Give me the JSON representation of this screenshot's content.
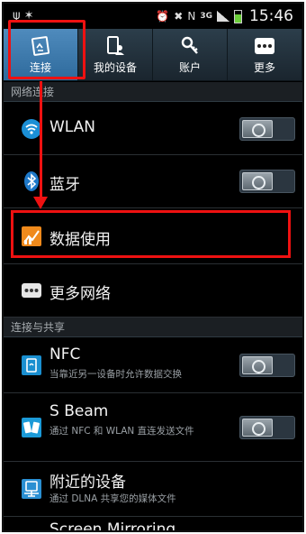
{
  "status_bar": {
    "left_icons": [
      "usb-icon",
      "notification-icon"
    ],
    "network": "3G",
    "time": "15:46"
  },
  "tabs": [
    {
      "label": "连接",
      "icon": "connection-icon",
      "active": true
    },
    {
      "label": "我的设备",
      "icon": "my-device-icon",
      "active": false
    },
    {
      "label": "账户",
      "icon": "account-key-icon",
      "active": false
    },
    {
      "label": "更多",
      "icon": "more-icon",
      "active": false
    }
  ],
  "sections": {
    "network": "网络连接",
    "sharing": "连接与共享"
  },
  "rows": {
    "wlan": {
      "title": "WLAN",
      "toggle": "off"
    },
    "bluetooth": {
      "title": "蓝牙",
      "toggle": "off"
    },
    "data_usage": {
      "title": "数据使用"
    },
    "more_networks": {
      "title": "更多网络"
    },
    "nfc": {
      "title": "NFC",
      "subtitle": "当靠近另一设备时允许数据交换",
      "toggle": "off"
    },
    "s_beam": {
      "title": "S Beam",
      "subtitle": "通过 NFC 和 WLAN 直连发送文件",
      "toggle": "off"
    },
    "nearby": {
      "title": "附近的设备",
      "subtitle": "通过 DLNA 共享您的媒体文件"
    },
    "mirroring": {
      "title": "Screen Mirroring"
    }
  },
  "colors": {
    "highlight_red": "#e11111",
    "tab_active": "#3f7db0",
    "background": "#000000"
  }
}
